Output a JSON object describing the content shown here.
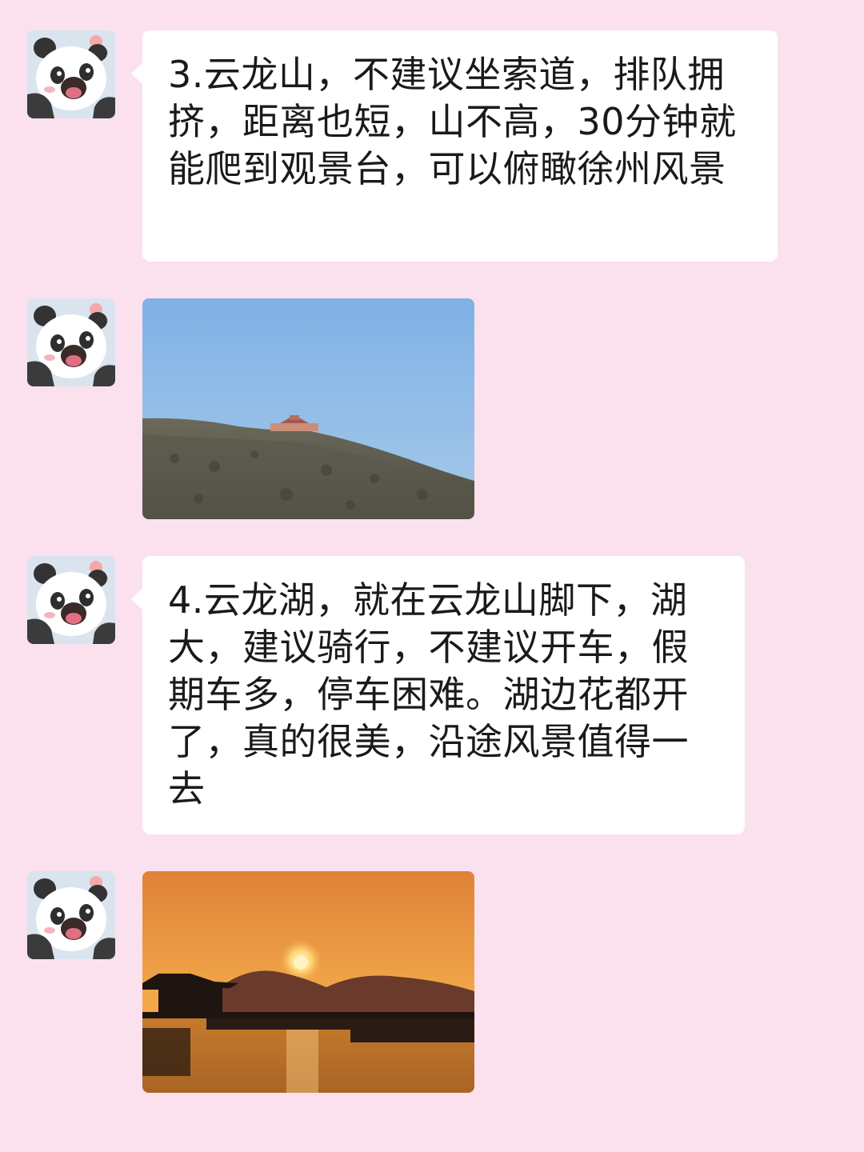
{
  "chat": {
    "messages": [
      {
        "type": "text",
        "avatar_icon": "panda-avatar-icon",
        "text": "3.云龙山，不建议坐索道，排队拥挤，距离也短，山不高，30分钟就能爬到观景台，可以俯瞰徐州风景"
      },
      {
        "type": "image",
        "avatar_icon": "panda-avatar-icon",
        "image": "hill-pavilion-photo"
      },
      {
        "type": "text",
        "avatar_icon": "panda-avatar-icon",
        "text": "4.云龙湖，就在云龙山脚下，湖大，建议骑行，不建议开车，假期车多，停车困难。湖边花都开了，真的很美，沿途风景值得一去"
      },
      {
        "type": "image",
        "avatar_icon": "panda-avatar-icon",
        "image": "lake-sunset-photo"
      }
    ]
  },
  "colors": {
    "background": "#fbe1ee",
    "bubble": "#ffffff",
    "text": "#1a1a1a"
  }
}
